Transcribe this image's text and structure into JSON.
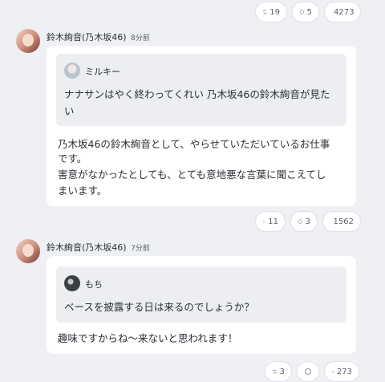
{
  "top_reactions": {
    "repost": "19",
    "reply": "5",
    "cheer": "4273"
  },
  "posts": [
    {
      "author": "鈴木絢音(乃木坂46)",
      "time": "8分前",
      "question_user": "ミルキー",
      "question_line1": "ナナサンはやく終わってくれい 乃木坂46の鈴木絢音が見た",
      "question_line2": "い",
      "answer_line1": "乃木坂46の鈴木絢音として、やらせていただいているお仕事",
      "answer_line2": "です。",
      "answer_line3": "害意がなかったとしても、とても意地悪な言葉に聞こえてし",
      "answer_line4": "まいます。",
      "reactions": {
        "repost": "11",
        "reply": "3",
        "cheer": "1562"
      }
    },
    {
      "author": "鈴木絢音(乃木坂46)",
      "time": "7分前",
      "question_user": "もち",
      "question_line1": "ベースを披露する日は来るのでしょうか？",
      "answer_line1": "趣味ですからね～来ないと思われます！",
      "reactions": {
        "repost": "3",
        "reply": "",
        "cheer": "273"
      }
    }
  ],
  "icons": {
    "repost": "repost-icon",
    "reply": "reply-icon",
    "cheer": "cheer-icon"
  }
}
